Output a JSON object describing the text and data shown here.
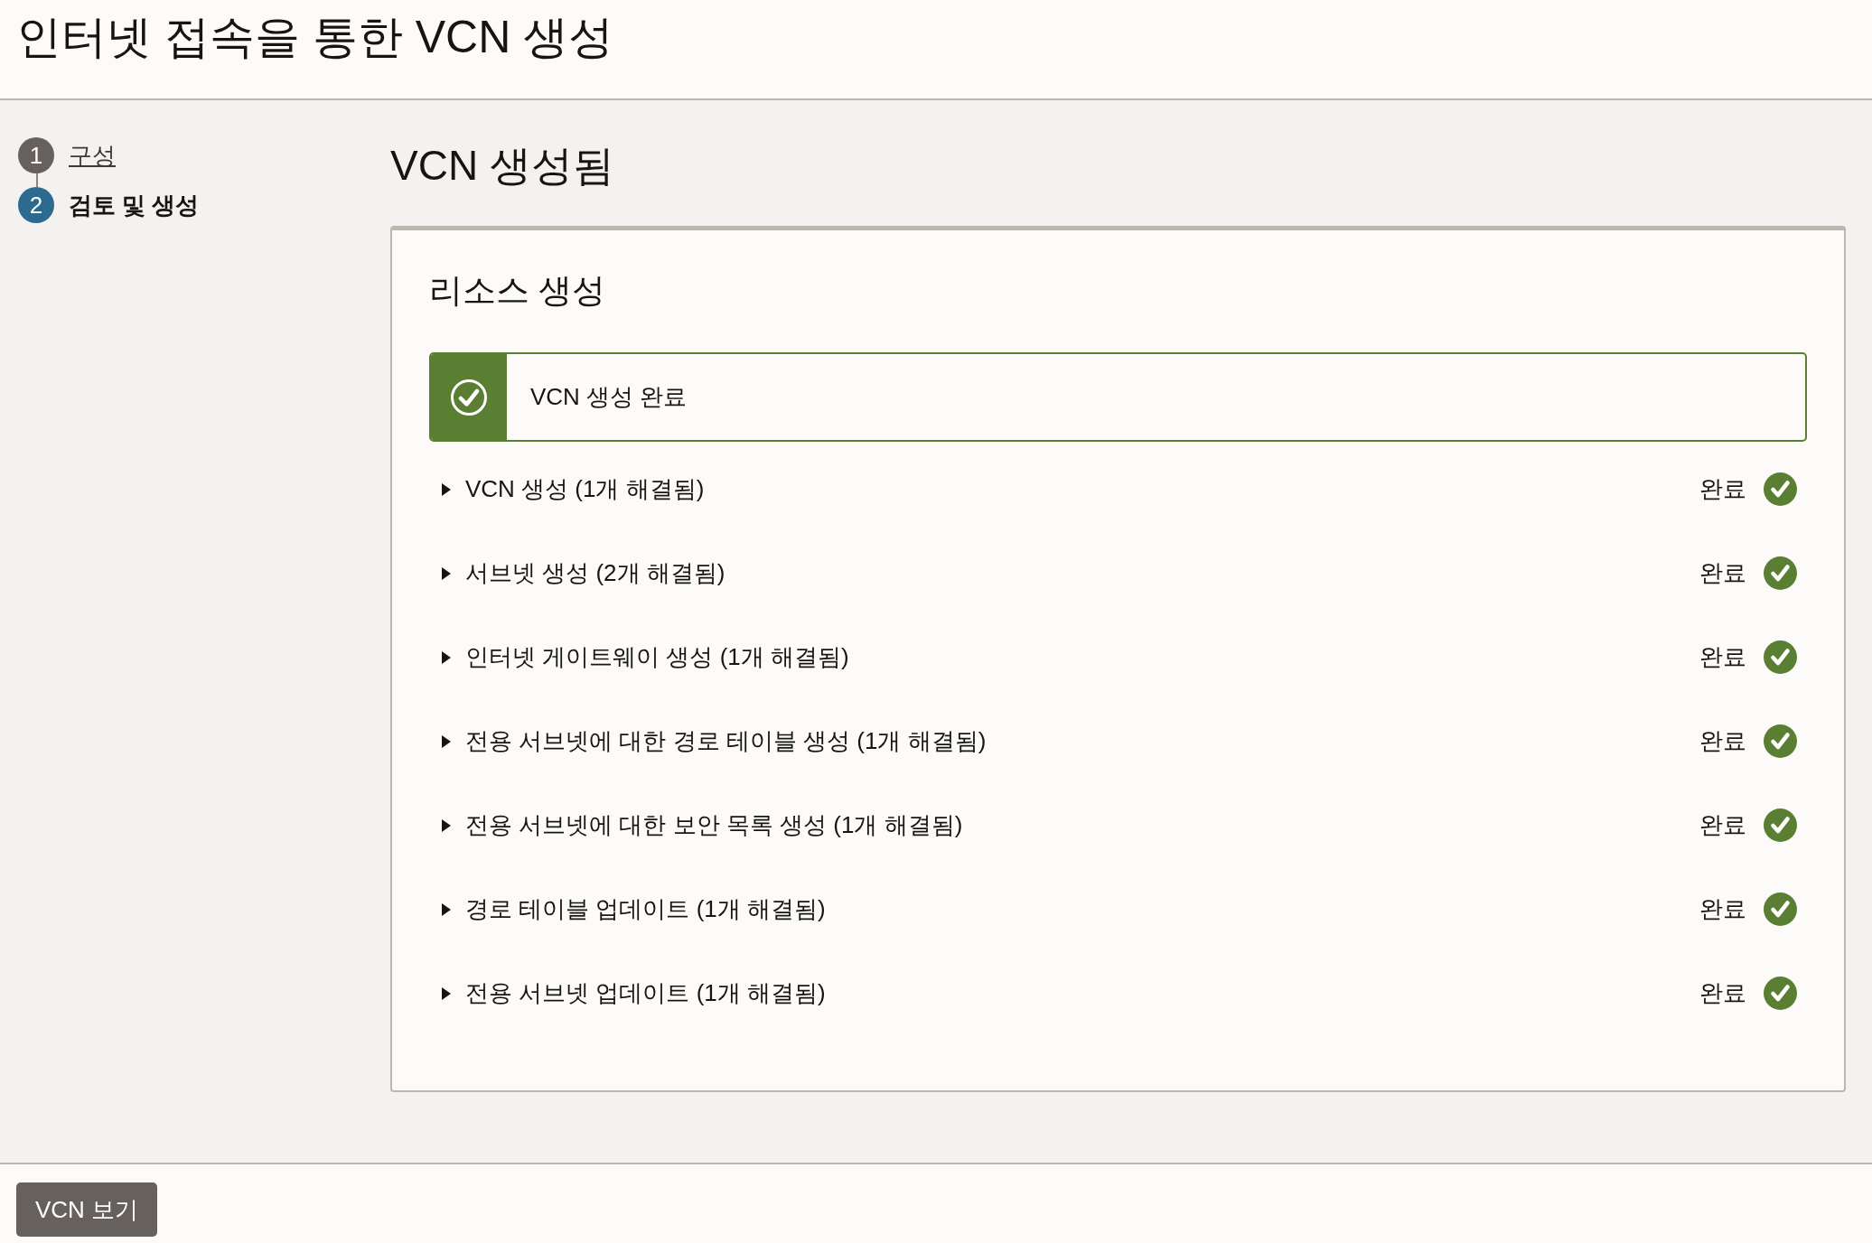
{
  "page": {
    "title": "인터넷 접속을 통한 VCN 생성"
  },
  "steps": [
    {
      "number": "1",
      "label": "구성",
      "selected": false
    },
    {
      "number": "2",
      "label": "검토 및 생성",
      "selected": true
    }
  ],
  "main": {
    "title": "VCN 생성됨"
  },
  "card": {
    "title": "리소스 생성",
    "banner": {
      "kind": "success",
      "message": "VCN 생성 완료"
    },
    "tasks": [
      {
        "label": "VCN 생성 (1개 해결됨)",
        "expanded": false,
        "status": "완료",
        "kind": "done"
      },
      {
        "label": "서브넷 생성 (2개 해결됨)",
        "expanded": false,
        "status": "완료",
        "kind": "done"
      },
      {
        "label": "인터넷 게이트웨이 생성 (1개 해결됨)",
        "expanded": false,
        "status": "완료",
        "kind": "done"
      },
      {
        "label": "전용 서브넷에 대한 경로 테이블 생성 (1개 해결됨)",
        "expanded": false,
        "status": "완료",
        "kind": "done"
      },
      {
        "label": "전용 서브넷에 대한 보안 목록 생성 (1개 해결됨)",
        "expanded": false,
        "status": "완료",
        "kind": "done"
      },
      {
        "label": "경로 테이블 업데이트 (1개 해결됨)",
        "expanded": false,
        "status": "완료",
        "kind": "done"
      },
      {
        "label": "전용 서브넷 업데이트 (1개 해결됨)",
        "expanded": false,
        "status": "완료",
        "kind": "done"
      }
    ]
  },
  "footer": {
    "buttons": [
      "VCN 보기"
    ]
  }
}
